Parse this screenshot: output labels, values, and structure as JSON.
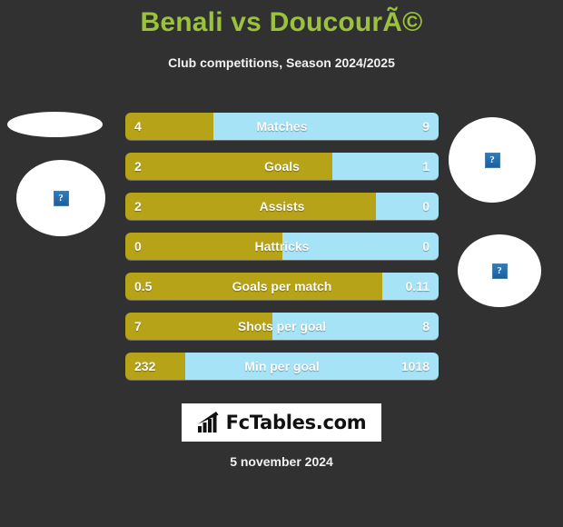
{
  "header": {
    "title": "Benali vs DoucourÃ©",
    "subtitle": "Club competitions, Season 2024/2025"
  },
  "crests": {
    "home_top_alt": "?",
    "home_main_alt": "?",
    "away_top_alt": "?",
    "away_main_alt": "?"
  },
  "footer": {
    "logo_text": "FcTables.com",
    "logo_icon": "bar-chart-icon",
    "date": "5 november 2024"
  },
  "colors": {
    "background": "#313131",
    "title": "#9ac23c",
    "home_bar": "#b6a318",
    "away_bar": "#a7e3f7",
    "text": "#ffffff"
  },
  "chart_data": {
    "type": "bar",
    "title": "Benali vs DoucourÃ©",
    "subtitle": "Club competitions, Season 2024/2025",
    "orientation": "horizontal-diverging",
    "legend": [
      "Benali",
      "DoucourÃ©"
    ],
    "legend_position": "none",
    "grid": false,
    "categories": [
      "Matches",
      "Goals",
      "Assists",
      "Hattricks",
      "Goals per match",
      "Shots per goal",
      "Min per goal"
    ],
    "series": [
      {
        "name": "Benali",
        "color": "#b6a318",
        "values": [
          4,
          2,
          2,
          0,
          0.5,
          7,
          232
        ],
        "labels": [
          "4",
          "2",
          "2",
          "0",
          "0.5",
          "7",
          "232"
        ]
      },
      {
        "name": "DoucourÃ©",
        "color": "#a7e3f7",
        "values": [
          9,
          1,
          0,
          0,
          0.11,
          8,
          1018
        ],
        "labels": [
          "9",
          "1",
          "0",
          "0",
          "0.11",
          "8",
          "1018"
        ]
      }
    ],
    "rows": [
      {
        "label": "Matches",
        "home": "4",
        "away": "9",
        "home_pct": 28
      },
      {
        "label": "Goals",
        "home": "2",
        "away": "1",
        "home_pct": 66
      },
      {
        "label": "Assists",
        "home": "2",
        "away": "0",
        "home_pct": 80
      },
      {
        "label": "Hattricks",
        "home": "0",
        "away": "0",
        "home_pct": 50
      },
      {
        "label": "Goals per match",
        "home": "0.5",
        "away": "0.11",
        "home_pct": 82
      },
      {
        "label": "Shots per goal",
        "home": "7",
        "away": "8",
        "home_pct": 47
      },
      {
        "label": "Min per goal",
        "home": "232",
        "away": "1018",
        "home_pct": 19
      }
    ],
    "footer_date": "5 november 2024"
  }
}
